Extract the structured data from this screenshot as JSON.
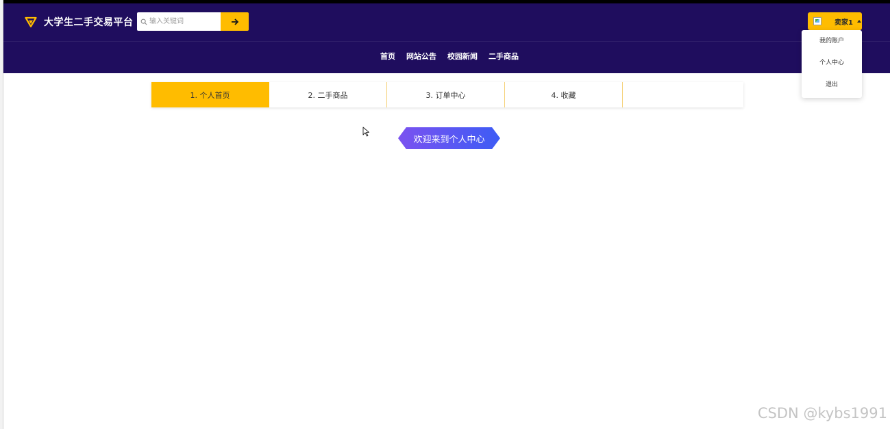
{
  "app": {
    "title": "大学生二手交易平台",
    "accent_color": "#ffbc00",
    "header_color": "#1f0d5e"
  },
  "search": {
    "placeholder": "输入关键词",
    "value": "",
    "icon": "search-icon",
    "submit_icon": "arrow-right-icon"
  },
  "nav": {
    "items": [
      {
        "label": "首页"
      },
      {
        "label": "网站公告"
      },
      {
        "label": "校园新闻"
      },
      {
        "label": "二手商品"
      }
    ]
  },
  "user": {
    "name": "卖家1",
    "menu": [
      {
        "label": "我的账户"
      },
      {
        "label": "个人中心"
      },
      {
        "label": "退出"
      }
    ]
  },
  "tabs": [
    {
      "label": "1. 个人首页",
      "active": true
    },
    {
      "label": "2. 二手商品",
      "active": false
    },
    {
      "label": "3. 订单中心",
      "active": false
    },
    {
      "label": "4. 收藏",
      "active": false
    },
    {
      "label": "",
      "active": false
    }
  ],
  "main": {
    "welcome": "欢迎来到个人中心"
  },
  "watermark": "CSDN @kybs1991"
}
